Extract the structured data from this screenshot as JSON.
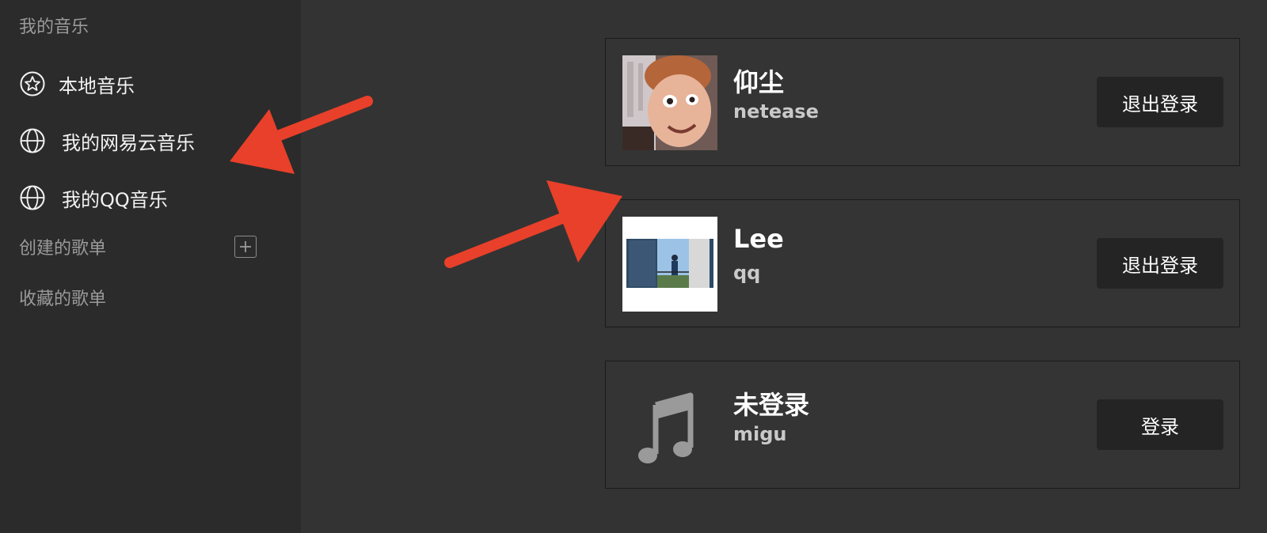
{
  "sidebar": {
    "my_music_title": "我的音乐",
    "items": [
      {
        "label": "本地音乐",
        "icon": "star-circle-icon"
      },
      {
        "label": "我的网易云音乐",
        "icon": "globe-icon"
      },
      {
        "label": "我的QQ音乐",
        "icon": "globe-icon"
      }
    ],
    "created_playlists_title": "创建的歌单",
    "add_icon": "plus-square-icon",
    "collected_playlists_title": "收藏的歌单"
  },
  "accounts": [
    {
      "name": "仰尘",
      "source": "netease",
      "button": "退出登录",
      "avatar": "photo-avatar"
    },
    {
      "name": "Lee",
      "source": "qq",
      "button": "退出登录",
      "avatar": "photo-avatar"
    },
    {
      "name": "未登录",
      "source": "migu",
      "button": "登录",
      "avatar": "music-note-icon"
    }
  ],
  "colors": {
    "background": "#333333",
    "sidebar": "#2b2b2b",
    "button": "#242424",
    "annotation_arrow": "#e8402a"
  }
}
